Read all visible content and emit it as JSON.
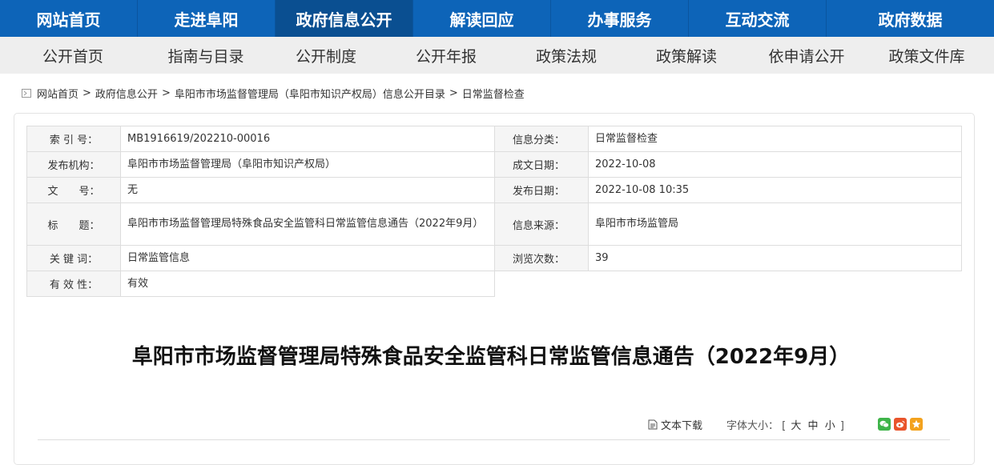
{
  "topnav": [
    "网站首页",
    "走进阜阳",
    "政府信息公开",
    "解读回应",
    "办事服务",
    "互动交流",
    "政府数据"
  ],
  "subnav": [
    "公开首页",
    "指南与目录",
    "公开制度",
    "公开年报",
    "政策法规",
    "政策解读",
    "依申请公开",
    "政策文件库"
  ],
  "breadcrumb": [
    "网站首页",
    "政府信息公开",
    "阜阳市市场监督管理局（阜阳市知识产权局）信息公开目录",
    "日常监督检查"
  ],
  "meta": {
    "index_label": "索 引 号：",
    "index_value": "MB1916619/202210-00016",
    "category_label": "信息分类：",
    "category_value": "日常监督检查",
    "publisher_label": "发布机构：",
    "publisher_value": "阜阳市市场监督管理局（阜阳市知识产权局）",
    "created_label": "成文日期：",
    "created_value": "2022-10-08",
    "docno_label": "文　　号：",
    "docno_value": "无",
    "published_label": "发布日期：",
    "published_value": "2022-10-08 10:35",
    "title_label": "标　　题：",
    "title_value": "阜阳市市场监督管理局特殊食品安全监管科日常监管信息通告（2022年9月）",
    "source_label": "信息来源：",
    "source_value": "阜阳市市场监管局",
    "keywords_label": "关 键 词：",
    "keywords_value": "日常监管信息",
    "views_label": "浏览次数：",
    "views_value": "39",
    "validity_label": "有 效 性：",
    "validity_value": "有效"
  },
  "article_title": "阜阳市市场监督管理局特殊食品安全监管科日常监管信息通告（2022年9月）",
  "tools": {
    "download": "文本下载",
    "font_size_label": "字体大小：",
    "lb": "[",
    "large": "大",
    "medium": "中",
    "small": "小",
    "rb": "]"
  }
}
